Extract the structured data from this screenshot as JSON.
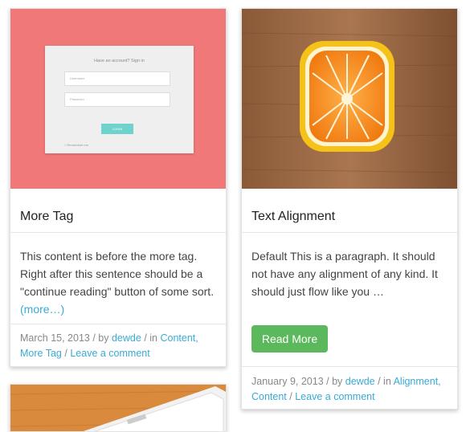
{
  "cards": [
    {
      "title": "More Tag",
      "image_alt": "login form screenshot",
      "login": {
        "heading": "Have an account? Sign in",
        "username_placeholder": "Username",
        "password_placeholder": "Password",
        "button": "LOGIN",
        "remember": "Remember me"
      },
      "excerpt": "This content is before the more tag. Right after this sentence should be a \"continue reading\" button of some sort.",
      "excerpt_more": "(more…)",
      "meta": {
        "date": "March 15, 2013",
        "by": "/ by",
        "author": "dewde",
        "in": "/ in",
        "categories": "Content,",
        "tag": "More Tag",
        "sep": "/",
        "comment": "Leave a comment"
      },
      "colors": {
        "thumb_bg": "#f07878"
      }
    },
    {
      "title": "Text Alignment",
      "image_alt": "square orange on wood",
      "excerpt": "Default This is a paragraph. It should not have any alignment of any kind. It should just flow like you …",
      "read_more": "Read More",
      "meta": {
        "date": "January 9, 2013",
        "by": "/ by",
        "author": "dewde",
        "in": "/ in",
        "categories": "Alignment,",
        "tag": "Content",
        "sep": "/",
        "comment": "Leave a comment"
      },
      "colors": {
        "read_more_bg": "#5cb85c"
      }
    }
  ],
  "colors": {
    "link": "#3aaad5",
    "text": "#444444"
  }
}
